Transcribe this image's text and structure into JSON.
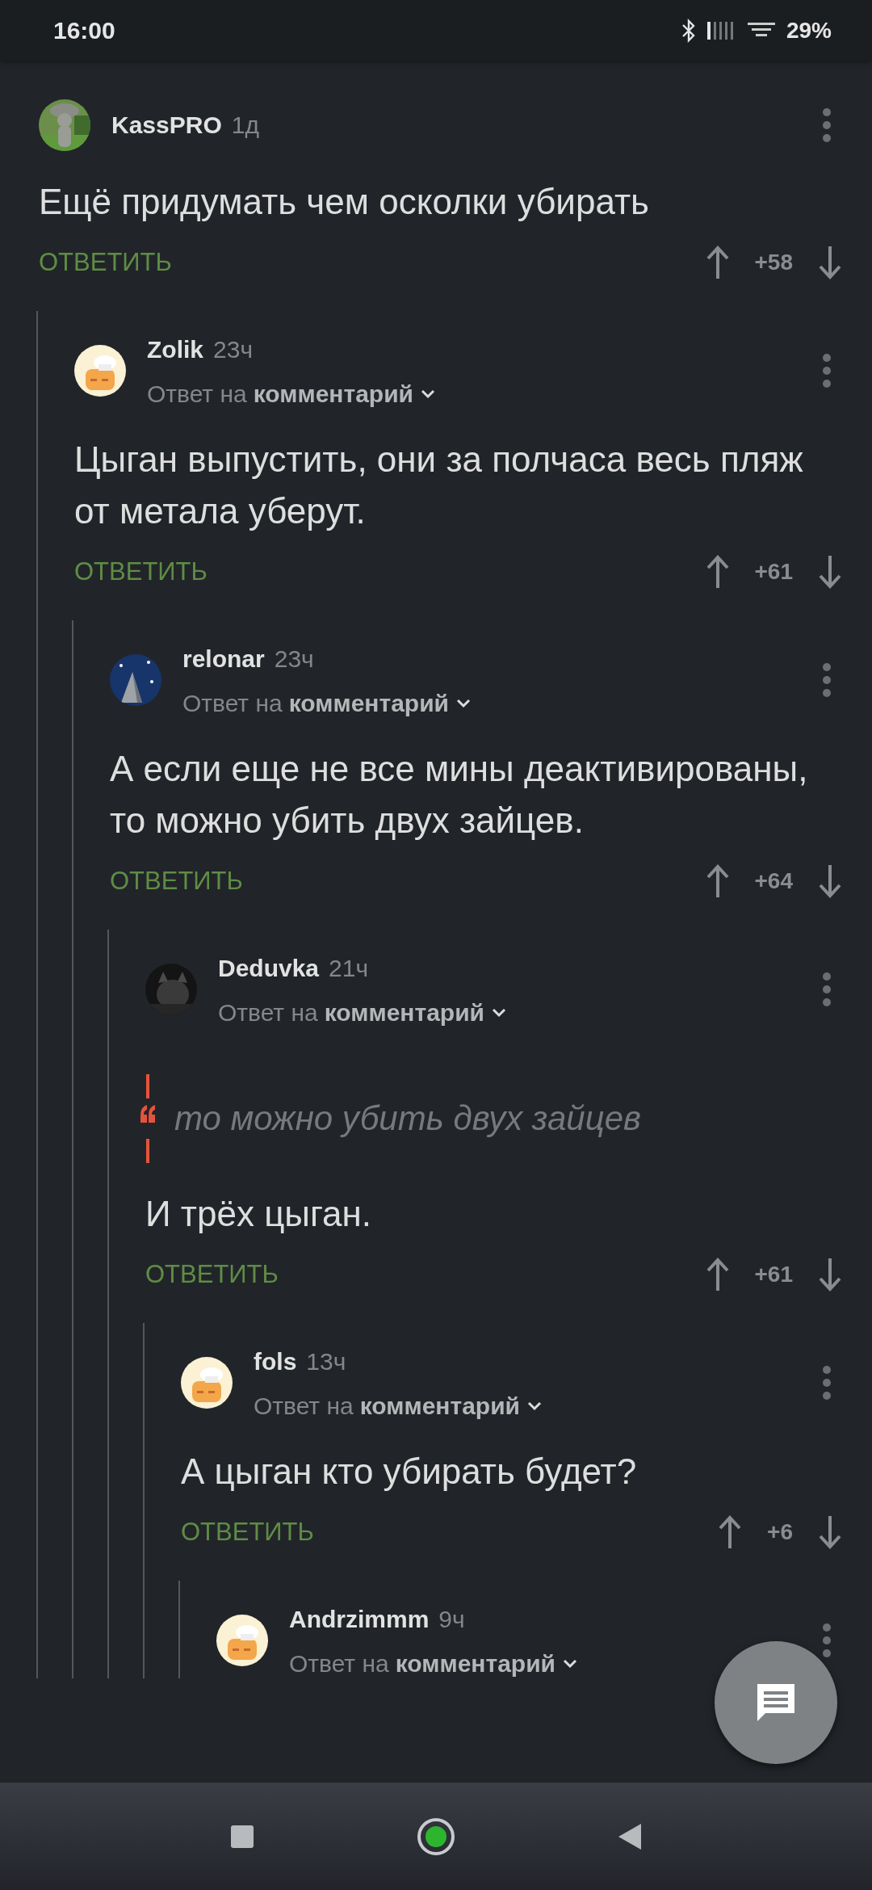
{
  "status_bar": {
    "time": "16:00",
    "battery": "29%"
  },
  "comments": [
    {
      "author": "KassPRO",
      "time": "1д",
      "text": "Ещё придумать чем осколки убирать",
      "reply_action": "ОТВЕТИТЬ",
      "score": "+58",
      "children": [
        {
          "author": "Zolik",
          "time": "23ч",
          "avatar": {
            "kind": "cartoon"
          },
          "reply_to": {
            "prefix": "Ответ на",
            "target": "комментарий"
          },
          "text": "Цыган выпустить, они за полчаса весь пляж от метала уберут.",
          "reply_action": "ОТВЕТИТЬ",
          "score": "+61",
          "children": [
            {
              "author": "relonar",
              "time": "23ч",
              "avatar": {
                "kind": "night"
              },
              "reply_to": {
                "prefix": "Ответ на",
                "target": "комментарий"
              },
              "text": "А если еще не все мины деактивированы, то можно убить двух зайцев.",
              "reply_action": "ОТВЕТИТЬ",
              "score": "+64",
              "children": [
                {
                  "author": "Deduvka",
                  "time": "21ч",
                  "avatar": {
                    "kind": "dark"
                  },
                  "reply_to": {
                    "prefix": "Ответ на",
                    "target": "комментарий"
                  },
                  "quote": "то можно убить двух зайцев",
                  "text": "И трёх цыган.",
                  "reply_action": "ОТВЕТИТЬ",
                  "score": "+61",
                  "children": [
                    {
                      "author": "fols",
                      "time": "13ч",
                      "avatar": {
                        "kind": "cartoon"
                      },
                      "reply_to": {
                        "prefix": "Ответ на",
                        "target": "комментарий"
                      },
                      "text": "А цыган кто убирать будет?",
                      "reply_action": "ОТВЕТИТЬ",
                      "score": "+6",
                      "children": [
                        {
                          "author": "Andrzimmm",
                          "time": "9ч",
                          "avatar": {
                            "kind": "cartoon"
                          },
                          "reply_to": {
                            "prefix": "Ответ на",
                            "target": "комментарий"
                          }
                        }
                      ]
                    }
                  ]
                }
              ]
            }
          ]
        }
      ]
    }
  ]
}
